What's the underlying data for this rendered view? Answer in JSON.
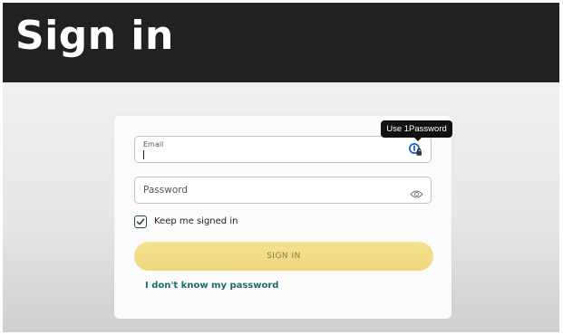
{
  "header": {
    "title": "Sign in"
  },
  "form": {
    "email": {
      "label": "Email",
      "value": ""
    },
    "password": {
      "placeholder": "Password",
      "value": ""
    },
    "password_manager_tooltip": "Use 1Password",
    "keep_signed_in": {
      "label": "Keep me signed in",
      "checked": true
    },
    "submit_label": "SIGN IN",
    "forgot_link": "I don't know my password"
  },
  "icons": {
    "password_manager": "1password-icon",
    "reveal_password": "eye-icon",
    "checkbox": "checkmark-icon"
  },
  "colors": {
    "banner": "#212121",
    "button": "#f2dc84",
    "link": "#1f6a74",
    "checkbox": "#1f4d3f"
  }
}
